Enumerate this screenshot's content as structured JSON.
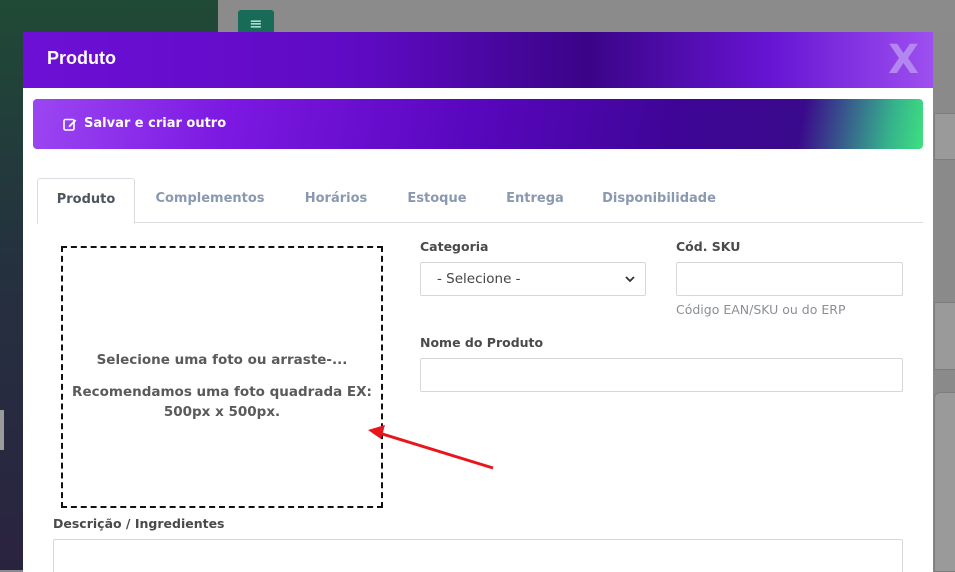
{
  "background": {
    "menu_icon": "hamburger-icon"
  },
  "modal": {
    "title": "Produto",
    "close_label": "X",
    "header_color": "#5e0ac2",
    "action_bar": {
      "save_label": "Salvar e criar outro",
      "save_icon": "edit-icon"
    },
    "tabs": [
      {
        "label": "Produto",
        "active": true
      },
      {
        "label": "Complementos",
        "active": false
      },
      {
        "label": "Horários",
        "active": false
      },
      {
        "label": "Estoque",
        "active": false
      },
      {
        "label": "Entrega",
        "active": false
      },
      {
        "label": "Disponibilidade",
        "active": false
      }
    ],
    "photo": {
      "title": "Selecione uma foto ou arraste-...",
      "hint": "Recomendamos uma foto quadrada EX: 500px x 500px."
    },
    "form": {
      "category_label": "Categoria",
      "category_value": "- Selecione -",
      "sku_label": "Cód. SKU",
      "sku_value": "",
      "sku_helper": "Código EAN/SKU ou do ERP",
      "name_label": "Nome do Produto",
      "name_value": "",
      "description_label": "Descrição / Ingredientes",
      "description_value": ""
    },
    "annotation_color": "#e8161b"
  }
}
